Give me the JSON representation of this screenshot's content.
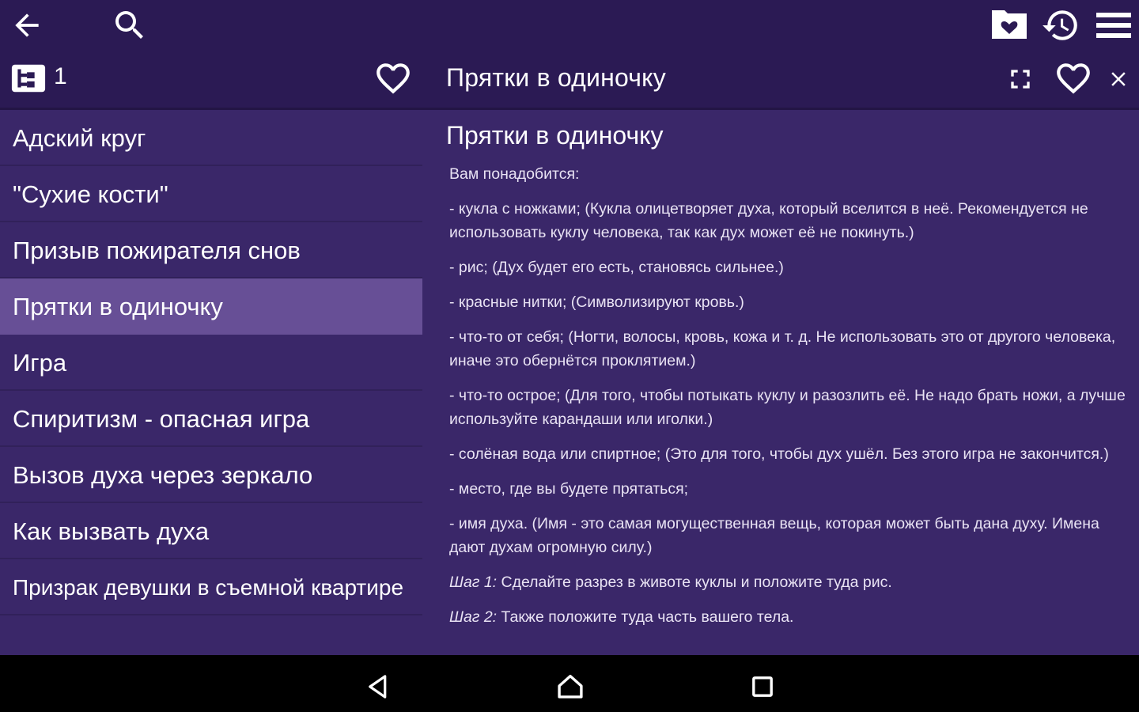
{
  "toolbar": {
    "icons": [
      "back-arrow-icon",
      "search-icon",
      "folder-heart-icon",
      "history-icon",
      "menu-icon"
    ]
  },
  "subbar": {
    "tree_icon": "tree-icon",
    "count": "1",
    "favorite_icon": "heart-outline-icon",
    "detail_title": "Прятки в одиночку",
    "detail_icons": [
      "fullscreen-icon",
      "heart-outline-icon",
      "close-icon"
    ]
  },
  "list": {
    "items": [
      {
        "label": "Адский круг"
      },
      {
        "label": "\"Сухие кости\""
      },
      {
        "label": "Призыв пожирателя снов"
      },
      {
        "label": "Прятки в одиночку",
        "selected": true
      },
      {
        "label": "Игра"
      },
      {
        "label": "Спиритизм - опасная игра"
      },
      {
        "label": "Вызов духа через зеркало"
      },
      {
        "label": "Как вызвать духа"
      },
      {
        "label": "Призрак девушки в съемной квартире"
      }
    ]
  },
  "detail": {
    "heading": "Прятки в одиночку",
    "paragraphs": [
      "Вам понадобится:",
      "- кукла с ножками; (Кукла олицетворяет духа, который вселится в неё. Рекомендуется не использовать куклу человека, так как дух может её не покинуть.)",
      "- рис; (Дух будет его есть, становясь сильнее.)",
      "- красные нитки; (Символизируют кровь.)",
      "- что-то от себя; (Ногти, волосы, кровь, кожа и т. д. Не использовать это от другого человека, иначе это обернётся проклятием.)",
      "- что-то острое; (Для того, чтобы потыкать куклу и разозлить её. Не надо брать ножи, а лучше используйте карандаши или иголки.)",
      "- солёная вода или спиртное; (Это для того, чтобы дух ушёл. Без этого игра не закончится.)",
      "- место, где вы будете прятаться;",
      "- имя духа. (Имя - это самая могущественная вещь, которая может быть дана духу. Имена дают духам огромную силу.)"
    ],
    "steps": [
      {
        "label": "Шаг 1:",
        "text": " Сделайте разрез в животе куклы и положите туда рис."
      },
      {
        "label": "Шаг 2:",
        "text": " Также положите туда часть вашего тела."
      }
    ]
  },
  "navbar": {
    "icons": [
      "nav-back-icon",
      "nav-home-icon",
      "nav-recents-icon"
    ]
  },
  "colors": {
    "appbar": "#2b1a54",
    "content": "#3a2769",
    "selected": "#674f96",
    "text": "#ffffff"
  }
}
